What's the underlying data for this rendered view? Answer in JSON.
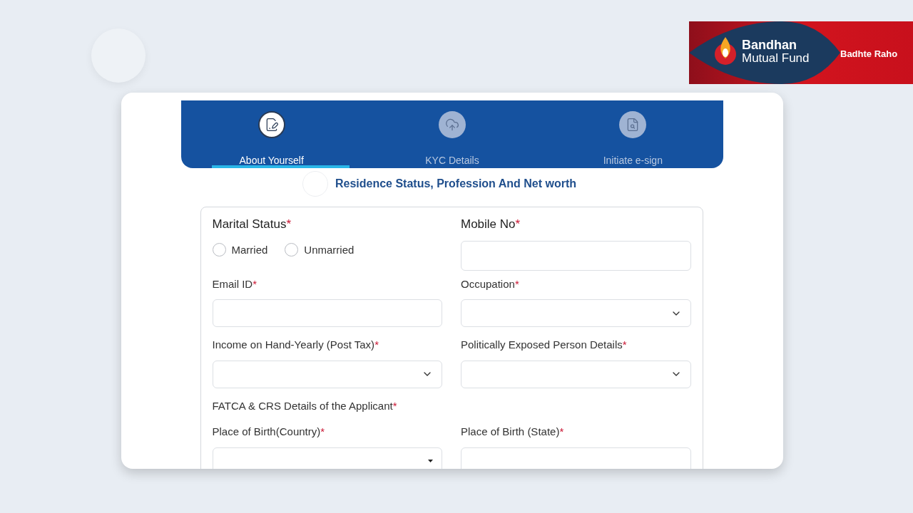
{
  "brand": {
    "name_line1": "Bandhan",
    "name_line2": "Mutual Fund",
    "tagline": "Badhte Raho"
  },
  "tabs": [
    {
      "label": "About Yourself",
      "selected": true
    },
    {
      "label": "KYC Details",
      "selected": false
    },
    {
      "label": "Initiate e-sign",
      "selected": false
    }
  ],
  "section_title": "Residence Status, Profession And Net worth",
  "rows": [
    {
      "fields": [
        {
          "kind": "radio",
          "label": "Marital Status",
          "required_mark": "*",
          "options": [
            {
              "label": "Married",
              "selected": false
            },
            {
              "label": "Unmarried",
              "selected": false
            }
          ]
        },
        {
          "kind": "text",
          "label": "Mobile No",
          "required_mark": "*"
        }
      ]
    },
    {
      "fields": [
        {
          "kind": "text",
          "label": "Email ID",
          "required_mark": "*"
        },
        {
          "kind": "select",
          "label": "Occupation",
          "required_mark": "*"
        }
      ]
    },
    {
      "fields": [
        {
          "kind": "select",
          "label": "Income on Hand-Yearly (Post Tax)",
          "required_mark": "*"
        },
        {
          "kind": "select",
          "label": "Politically Exposed Person Details",
          "required_mark": "*"
        }
      ]
    },
    {
      "fields": [
        {
          "kind": "heading",
          "label": "FATCA & CRS Details of the Applicant",
          "required_mark": "*"
        }
      ]
    },
    {
      "fields": [
        {
          "kind": "dropdown",
          "label": "Place of Birth(Country)",
          "required_mark": "*"
        },
        {
          "kind": "text",
          "label": "Place of Birth (State)",
          "required_mark": "*"
        }
      ]
    }
  ]
}
